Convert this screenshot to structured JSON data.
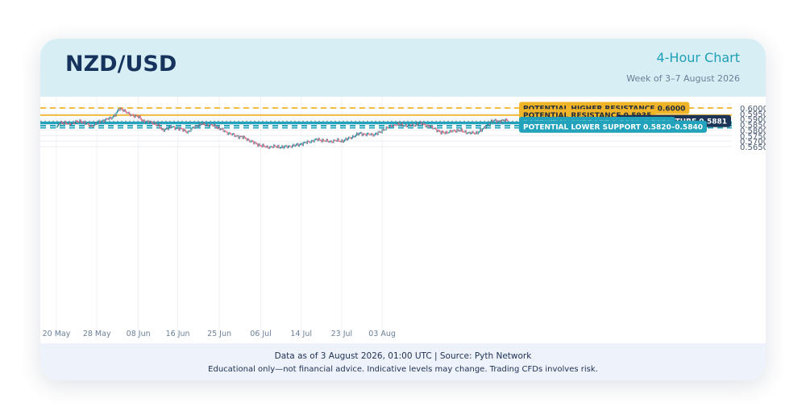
{
  "header": {
    "pair": "NZD/USD",
    "timeframe": "4-Hour Chart",
    "week": "Week of 3–7 August 2026"
  },
  "footer": {
    "line1": "Data as of 3 August 2026, 01:00 UTC  |  Source: Pyth Network",
    "line2": "Educational only—not financial advice. Indicative levels may change. Trading CFDs involves risk."
  },
  "colors": {
    "up": "#1a8a9c",
    "down": "#e0607a",
    "resistance": "#f0b429",
    "support": "#23a3bb",
    "capture": "#1c3557"
  },
  "chart_data": {
    "type": "candlestick",
    "x_tick_labels": [
      "20 May",
      "28 May",
      "08 Jun",
      "16 Jun",
      "25 Jun",
      "06 Jul",
      "14 Jul",
      "23 Jul",
      "03 Aug"
    ],
    "y_ticks": [
      0.6,
      0.595,
      0.59,
      0.585,
      0.58,
      0.575,
      0.57,
      0.565
    ],
    "ylim": [
      0.561,
      0.602
    ],
    "anchors": [
      [
        0,
        0.582
      ],
      [
        3,
        0.587
      ],
      [
        12,
        0.5855
      ],
      [
        24,
        0.588
      ],
      [
        34,
        0.5835
      ],
      [
        44,
        0.588
      ],
      [
        54,
        0.591
      ],
      [
        58,
        0.594
      ],
      [
        62,
        0.599
      ],
      [
        66,
        0.5985
      ],
      [
        72,
        0.594
      ],
      [
        80,
        0.5925
      ],
      [
        86,
        0.588
      ],
      [
        92,
        0.587
      ],
      [
        97,
        0.586
      ],
      [
        101,
        0.584
      ],
      [
        104,
        0.58
      ],
      [
        108,
        0.581
      ],
      [
        114,
        0.583
      ],
      [
        120,
        0.5815
      ],
      [
        126,
        0.58
      ],
      [
        130,
        0.578
      ],
      [
        136,
        0.583
      ],
      [
        144,
        0.5855
      ],
      [
        150,
        0.5845
      ],
      [
        156,
        0.584
      ],
      [
        160,
        0.582
      ],
      [
        164,
        0.58
      ],
      [
        168,
        0.578
      ],
      [
        176,
        0.575
      ],
      [
        184,
        0.5735
      ],
      [
        190,
        0.571
      ],
      [
        196,
        0.568
      ],
      [
        202,
        0.566
      ],
      [
        208,
        0.5645
      ],
      [
        216,
        0.565
      ],
      [
        224,
        0.5645
      ],
      [
        228,
        0.565
      ],
      [
        236,
        0.566
      ],
      [
        244,
        0.568
      ],
      [
        252,
        0.57
      ],
      [
        258,
        0.5715
      ],
      [
        264,
        0.5705
      ],
      [
        270,
        0.5695
      ],
      [
        276,
        0.5705
      ],
      [
        282,
        0.57
      ],
      [
        288,
        0.572
      ],
      [
        294,
        0.5745
      ],
      [
        300,
        0.577
      ],
      [
        306,
        0.576
      ],
      [
        314,
        0.576
      ],
      [
        320,
        0.578
      ],
      [
        324,
        0.581
      ],
      [
        330,
        0.583
      ],
      [
        336,
        0.5855
      ],
      [
        342,
        0.5845
      ],
      [
        348,
        0.584
      ],
      [
        354,
        0.5845
      ],
      [
        358,
        0.586
      ],
      [
        362,
        0.5855
      ],
      [
        366,
        0.584
      ],
      [
        370,
        0.5825
      ],
      [
        374,
        0.5815
      ],
      [
        380,
        0.5775
      ],
      [
        386,
        0.578
      ],
      [
        392,
        0.579
      ],
      [
        398,
        0.58
      ],
      [
        402,
        0.5785
      ],
      [
        408,
        0.5775
      ],
      [
        414,
        0.577
      ],
      [
        418,
        0.579
      ],
      [
        422,
        0.581
      ],
      [
        426,
        0.585
      ],
      [
        430,
        0.588
      ],
      [
        434,
        0.5885
      ],
      [
        438,
        0.588
      ],
      [
        442,
        0.5885
      ],
      [
        446,
        0.589
      ]
    ],
    "x_tick_positions": [
      0,
      40,
      81,
      120,
      161,
      202,
      242,
      282,
      322
    ],
    "levels": [
      {
        "label": "POTENTIAL HIGHER RESISTANCE 0.6000",
        "value": 0.6,
        "kind": "resistance",
        "style": "dashed"
      },
      {
        "label": "POTENTIAL RESISTANCE 0.5935",
        "value": 0.5935,
        "kind": "resistance",
        "style": "solid"
      },
      {
        "label": "PRICE AT CAPTURE 0.5881",
        "value": 0.5881,
        "kind": "capture",
        "style": "dotted"
      },
      {
        "label": "POTENTIAL SUPPORT 0.5860–0.5870",
        "low": 0.586,
        "high": 0.587,
        "kind": "support",
        "style": "solid"
      },
      {
        "label": "POTENTIAL LOWER SUPPORT 0.5820–0.5840",
        "low": 0.582,
        "high": 0.584,
        "kind": "support",
        "style": "dashed"
      }
    ]
  }
}
